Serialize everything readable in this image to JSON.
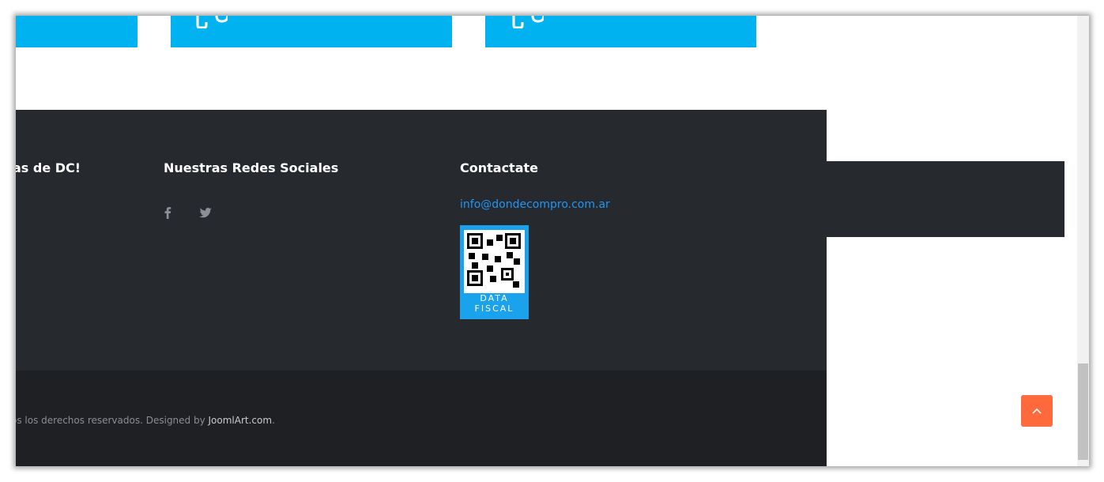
{
  "footer": {
    "col1_title": "as de DC!",
    "col2_title": "Nuestras Redes Sociales",
    "col3_title": "Contactate",
    "social": [
      "facebook-icon",
      "twitter-icon"
    ],
    "email": "info@dondecompro.com.ar",
    "qr": {
      "line1": "DATA",
      "line2": "FISCAL"
    }
  },
  "bottom": {
    "copyright_prefix": "os los derechos reservados. Designed by ",
    "designer_link": "JoomlArt.com",
    "copyright_suffix": "."
  },
  "scroll_top_icon": "chevron-up-icon",
  "colors": {
    "accent_blue": "#00b3f0",
    "footer_bg": "#26292e",
    "bottom_bg": "#1f2024",
    "link": "#2196f3",
    "scroll_button": "#ff6a3d"
  }
}
